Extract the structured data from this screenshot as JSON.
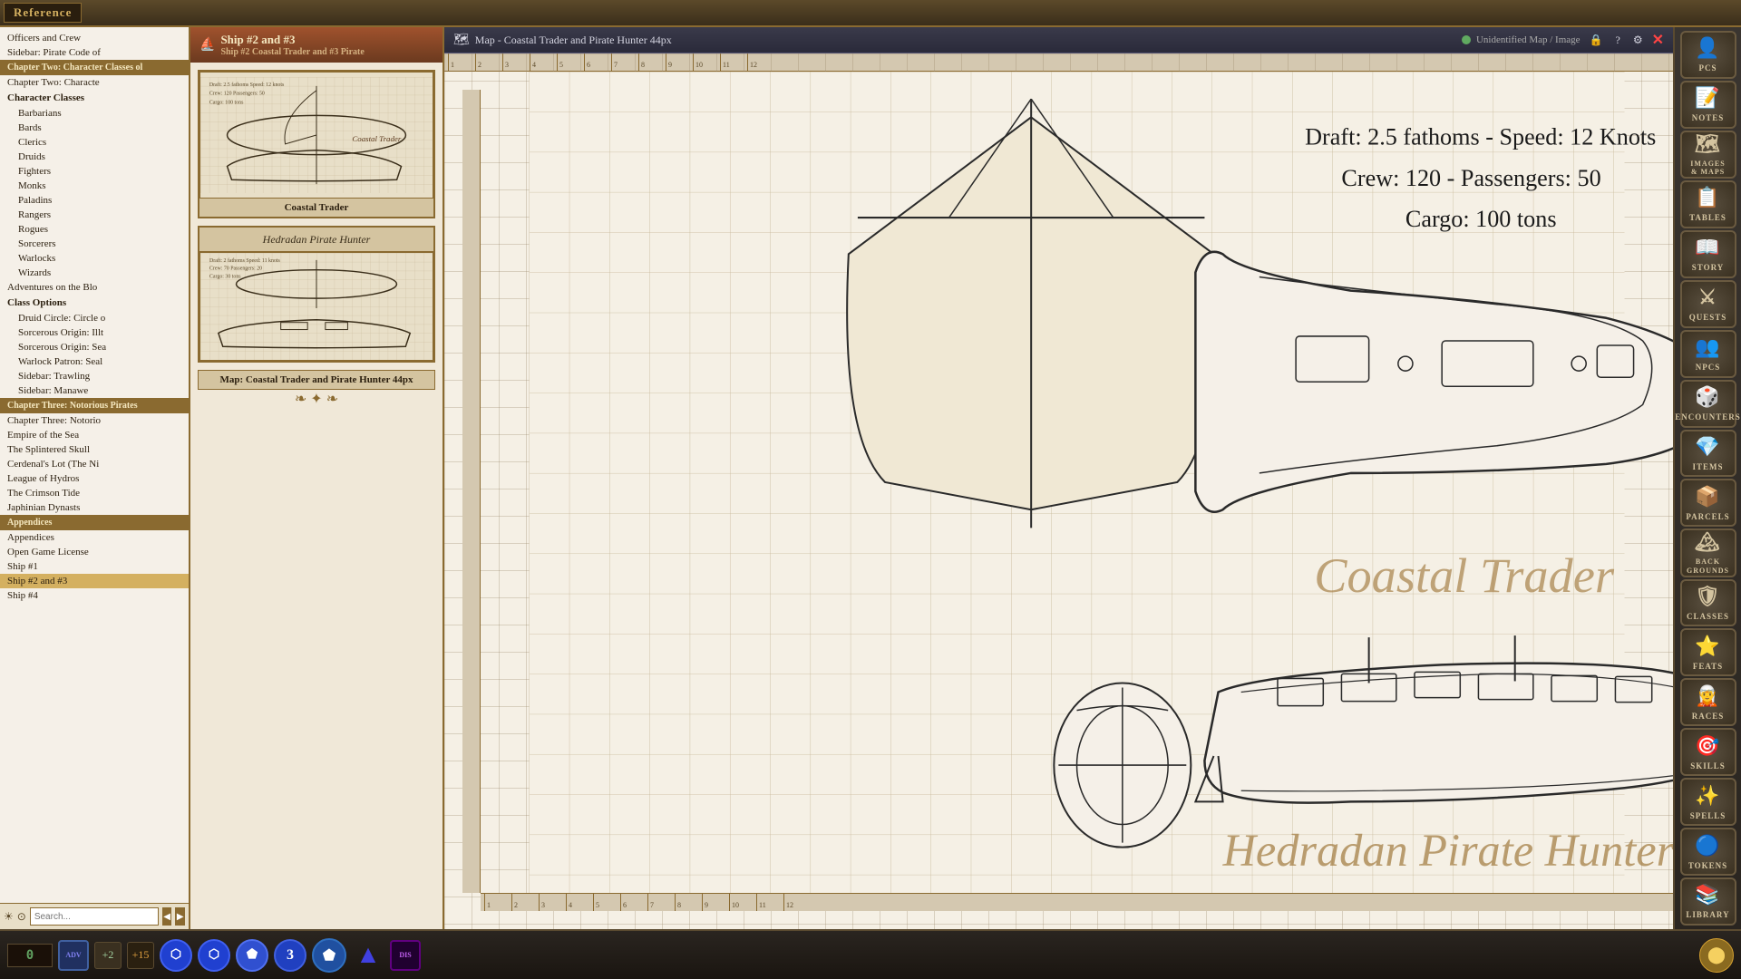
{
  "app": {
    "title": "Reference"
  },
  "sidebar": {
    "items": [
      {
        "label": "Officers and Crew",
        "type": "item"
      },
      {
        "label": "Sidebar: Pirate Code of",
        "type": "item"
      },
      {
        "label": "Chapter Two: Characte Classes ol",
        "type": "chapter"
      },
      {
        "label": "Chapter Two: Characte",
        "type": "item"
      },
      {
        "label": "Character Classes",
        "type": "section"
      },
      {
        "label": "Barbarians",
        "type": "indented"
      },
      {
        "label": "Bards",
        "type": "indented"
      },
      {
        "label": "Clerics",
        "type": "indented"
      },
      {
        "label": "Druids",
        "type": "indented"
      },
      {
        "label": "Fighters",
        "type": "indented"
      },
      {
        "label": "Monks",
        "type": "indented"
      },
      {
        "label": "Paladins",
        "type": "indented"
      },
      {
        "label": "Rangers",
        "type": "indented"
      },
      {
        "label": "Rogues",
        "type": "indented"
      },
      {
        "label": "Sorcerers",
        "type": "indented"
      },
      {
        "label": "Warlocks",
        "type": "indented"
      },
      {
        "label": "Wizards",
        "type": "indented"
      },
      {
        "label": "Adventures on the Blo",
        "type": "item"
      },
      {
        "label": "Class Options",
        "type": "section"
      },
      {
        "label": "Druid Circle: Circle o",
        "type": "indented"
      },
      {
        "label": "Sorcerous Origin: Illt",
        "type": "indented"
      },
      {
        "label": "Sorcerous Origin: Sea",
        "type": "indented"
      },
      {
        "label": "Warlock Patron: Seal",
        "type": "indented"
      },
      {
        "label": "Sidebar: Trawling",
        "type": "indented"
      },
      {
        "label": "Sidebar: Manawe",
        "type": "indented"
      },
      {
        "label": "Chapter Three: Notorious Pirates",
        "type": "chapter"
      },
      {
        "label": "Chapter Three: Notorio",
        "type": "item"
      },
      {
        "label": "Empire of the Sea",
        "type": "item"
      },
      {
        "label": "The Splintered Skull",
        "type": "item"
      },
      {
        "label": "Cerdenal's Lot (The Ni",
        "type": "item"
      },
      {
        "label": "League of Hydros",
        "type": "item"
      },
      {
        "label": "The Crimson Tide",
        "type": "item"
      },
      {
        "label": "Japhinian Dynasts",
        "type": "item"
      },
      {
        "label": "Appendices",
        "type": "chapter"
      },
      {
        "label": "Appendices",
        "type": "item"
      },
      {
        "label": "Open Game License",
        "type": "item"
      },
      {
        "label": "Ship #1",
        "type": "item"
      },
      {
        "label": "Ship #2 and #3",
        "type": "item"
      },
      {
        "label": "Ship #4",
        "type": "item"
      }
    ]
  },
  "middle_panel": {
    "header_title": "Ship #2 and #3",
    "subheader": "Ship #2 Coastal Trader and #3 Pirate",
    "map_label": "Map: Coastal Trader and Pirate Hunter 44px",
    "coastal_trader_label": "Coastal Trader",
    "pirate_hunter_label": "Hedradan Pirate Hunter"
  },
  "map": {
    "title": "Map - Coastal Trader and Pirate Hunter 44px",
    "status_label": "Unidentified Map / Image",
    "stats": {
      "draft": "Draft: 2.5 fathoms  -  Speed: 12 Knots",
      "crew": "Crew: 120  -  Passengers: 50",
      "cargo": "Cargo: 100 tons"
    },
    "ship_labels": {
      "coastal_trader": "Coastal Trader",
      "pirate_hunter": "Hedradan Pirate Hunter"
    },
    "ruler_marks": [
      "1",
      "2",
      "3",
      "4",
      "5",
      "6",
      "7",
      "8",
      "9",
      "10",
      "11",
      "12"
    ]
  },
  "right_sidebar": {
    "buttons": [
      {
        "label": "PCs",
        "icon": "👤"
      },
      {
        "label": "Notes",
        "icon": "📝"
      },
      {
        "label": "Images\n& Maps",
        "icon": "🗺"
      },
      {
        "label": "Tables",
        "icon": "📋"
      },
      {
        "label": "Story",
        "icon": "📖"
      },
      {
        "label": "Quests",
        "icon": "⚔"
      },
      {
        "label": "NPCs",
        "icon": "👥"
      },
      {
        "label": "Encounters",
        "icon": "🎲"
      },
      {
        "label": "Items",
        "icon": "💎"
      },
      {
        "label": "Parcels",
        "icon": "📦"
      },
      {
        "label": "Back\ngrounds",
        "icon": "🏔"
      },
      {
        "label": "Classes",
        "icon": "🛡"
      },
      {
        "label": "Feats",
        "icon": "⭐"
      },
      {
        "label": "Races",
        "icon": "🧝"
      },
      {
        "label": "Skills",
        "icon": "🎯"
      },
      {
        "label": "Spells",
        "icon": "✨"
      },
      {
        "label": "Tokens",
        "icon": "🔵"
      },
      {
        "label": "Library",
        "icon": "📚"
      }
    ]
  },
  "bottom_bar": {
    "xp_value": "0",
    "advantage_label": "ADV",
    "disadvantage_label": "DIS",
    "modifier_plus2": "+2",
    "modifier_plus5": "+15"
  }
}
